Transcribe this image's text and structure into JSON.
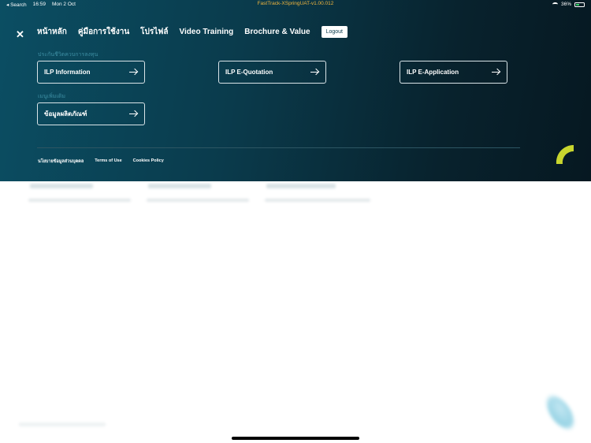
{
  "status_bar": {
    "back_label": "◂ Search",
    "time": "16:59",
    "date": "Mon 2 Oct",
    "app_version": "FastTrack-XSpringUAT-v1.00.012",
    "battery": "36%",
    "battery_level": 0.36
  },
  "nav": {
    "items": [
      "หน้าหลัก",
      "คู่มือการใช้งาน",
      "โปรไฟล์",
      "Video Training",
      "Brochure & Value"
    ],
    "logout_label": "Logout"
  },
  "sections": [
    {
      "label": "ประกันชีวิตควบการลงทุน",
      "cards": [
        "ILP Information",
        "ILP E-Quotation",
        "ILP E-Application"
      ]
    },
    {
      "label": "เมนูเพิ่มเติม",
      "cards": [
        "ข้อมูลผลิตภัณฑ์"
      ]
    }
  ],
  "footer": {
    "links": [
      "นโยบายข้อมูลส่วนบุคคล",
      "Terms of Use",
      "Cookies Policy"
    ]
  },
  "colors": {
    "overlay_start": "#0b4e63",
    "overlay_end": "#061821",
    "accent_yellow": "#c8d62e",
    "version_text": "#f2b63d"
  }
}
